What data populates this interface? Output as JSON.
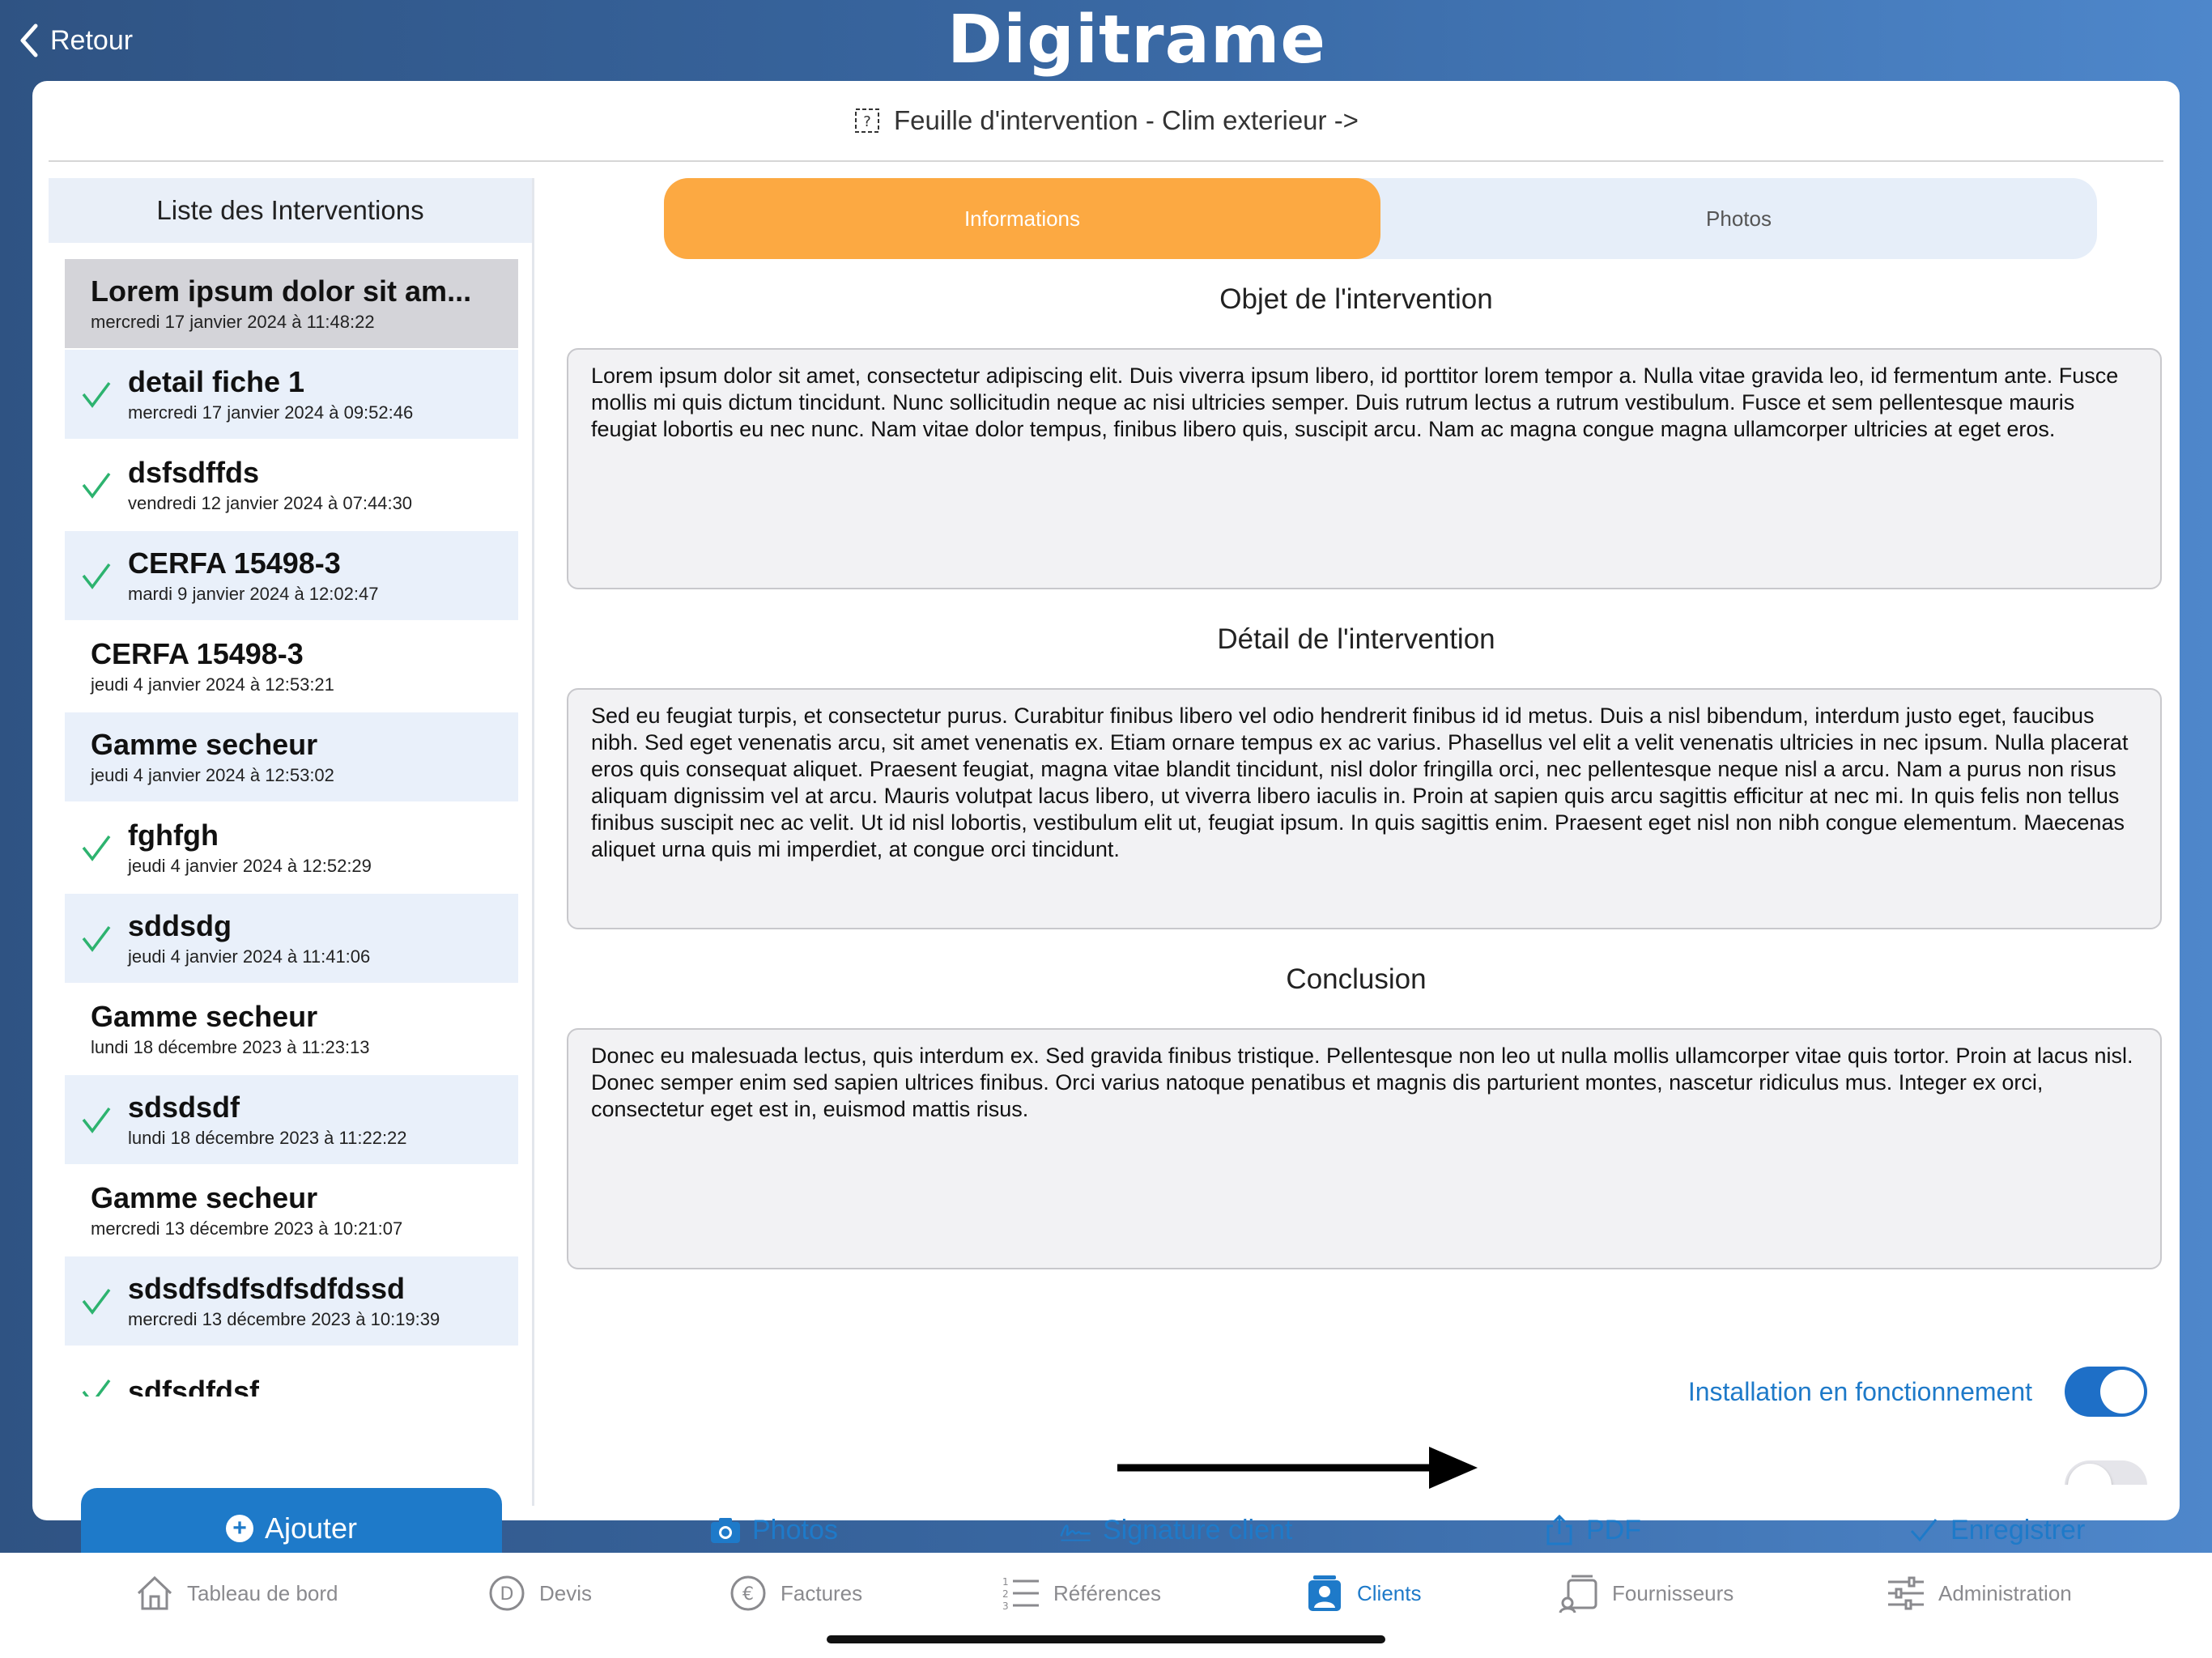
{
  "header": {
    "back_label": "Retour",
    "logo": "Digitrame"
  },
  "card": {
    "title": "Feuille d'intervention - Clim exterieur ->"
  },
  "list": {
    "heading": "Liste des Interventions",
    "items": [
      {
        "title": "Lorem ipsum dolor sit am...",
        "date": "mercredi 17 janvier 2024 à 11:48:22",
        "checked": false,
        "style": "selected"
      },
      {
        "title": "detail fiche 1",
        "date": "mercredi 17 janvier 2024 à 09:52:46",
        "checked": true,
        "style": "alt"
      },
      {
        "title": "dsfsdffds",
        "date": "vendredi 12 janvier 2024 à 07:44:30",
        "checked": true,
        "style": "plain"
      },
      {
        "title": "CERFA 15498-3",
        "date": "mardi 9 janvier 2024 à 12:02:47",
        "checked": true,
        "style": "alt"
      },
      {
        "title": "CERFA 15498-3",
        "date": "jeudi 4 janvier 2024 à 12:53:21",
        "checked": false,
        "style": "plain"
      },
      {
        "title": "Gamme secheur",
        "date": "jeudi 4 janvier 2024 à 12:53:02",
        "checked": false,
        "style": "alt"
      },
      {
        "title": "fghfgh",
        "date": "jeudi 4 janvier 2024 à 12:52:29",
        "checked": true,
        "style": "plain"
      },
      {
        "title": "sddsdg",
        "date": "jeudi 4 janvier 2024 à 11:41:06",
        "checked": true,
        "style": "alt"
      },
      {
        "title": "Gamme secheur",
        "date": "lundi 18 décembre 2023 à 11:23:13",
        "checked": false,
        "style": "plain"
      },
      {
        "title": "sdsdsdf",
        "date": "lundi 18 décembre 2023 à 11:22:22",
        "checked": true,
        "style": "alt"
      },
      {
        "title": "Gamme secheur",
        "date": "mercredi 13 décembre 2023 à 10:21:07",
        "checked": false,
        "style": "plain"
      },
      {
        "title": "sdsdfsdfsdfsdfdssd",
        "date": "mercredi 13 décembre 2023 à 10:19:39",
        "checked": true,
        "style": "alt"
      },
      {
        "title": "sdfsdfdsf",
        "date": "",
        "checked": true,
        "style": "plain"
      }
    ],
    "add_label": "Ajouter"
  },
  "tabs": {
    "informations": "Informations",
    "photos": "Photos",
    "active": "informations"
  },
  "sections": {
    "objet_title": "Objet de l'intervention",
    "objet_text": "Lorem ipsum dolor sit amet, consectetur adipiscing elit. Duis viverra ipsum libero, id porttitor lorem tempor a. Nulla vitae gravida leo, id fermentum ante. Fusce mollis mi quis dictum tincidunt. Nunc sollicitudin neque ac nisi ultricies semper. Duis rutrum lectus a rutrum vestibulum. Fusce et sem pellentesque mauris feugiat lobortis eu nec nunc. Nam vitae dolor tempus, finibus libero quis, suscipit arcu. Nam ac magna congue magna ullamcorper ultricies at eget eros.",
    "detail_title": "Détail de l'intervention",
    "detail_text": "Sed eu feugiat turpis, et consectetur purus. Curabitur finibus libero vel odio hendrerit finibus id id metus. Duis a nisl bibendum, interdum justo eget, faucibus nibh. Sed eget venenatis arcu, sit amet venenatis ex. Etiam ornare tempus ex ac varius. Phasellus vel elit a velit venenatis ultricies in nec ipsum. Nulla placerat eros quis consequat aliquet. Praesent feugiat, magna vitae blandit tincidunt, nisl dolor fringilla orci, nec pellentesque neque nisl a arcu. Nam a purus non risus aliquam dignissim vel at arcu. Mauris volutpat lacus libero, ut viverra libero iaculis in. Proin at sapien quis arcu sagittis efficitur at nec mi. In quis felis non tellus finibus suscipit nec ac velit. Ut id nisl lobortis, vestibulum elit ut, feugiat ipsum. In quis sagittis enim. Praesent eget nisl non nibh congue elementum. Maecenas aliquet urna quis mi imperdiet, at congue orci tincidunt.",
    "conclusion_title": "Conclusion",
    "conclusion_text": "Donec eu malesuada lectus, quis interdum ex. Sed gravida finibus tristique. Pellentesque non leo ut nulla mollis ullamcorper vitae quis tortor. Proin at lacus nisl. Donec semper enim sed sapien ultrices finibus. Orci varius natoque penatibus et magnis dis parturient montes, nascetur ridiculus mus. Integer ex orci, consectetur eget est in, euismod mattis risus."
  },
  "toggle": {
    "label": "Installation en fonctionnement",
    "on": true
  },
  "actions": {
    "photos": "Photos",
    "signature": "Signature client",
    "pdf": "PDF",
    "save": "Enregistrer"
  },
  "tabbar": {
    "items": [
      "Tableau de bord",
      "Devis",
      "Factures",
      "Références",
      "Clients",
      "Fournisseurs",
      "Administration"
    ],
    "active": "Clients"
  },
  "colors": {
    "accent": "#1e7ac9",
    "tab_active": "#fca942",
    "check": "#2db36f"
  }
}
